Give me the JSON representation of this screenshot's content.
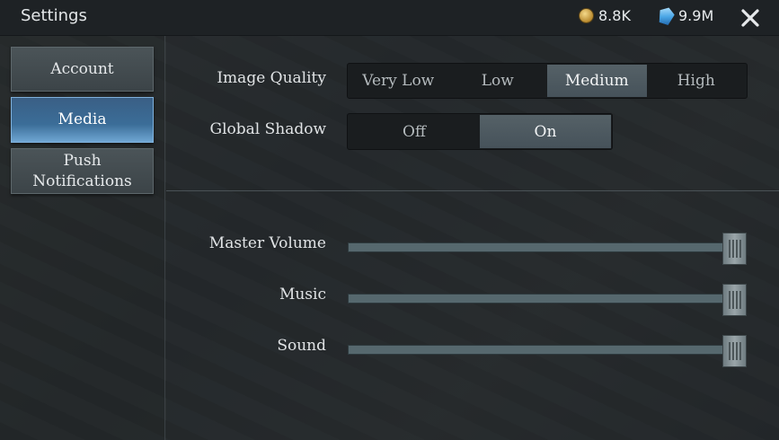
{
  "header": {
    "title": "Settings",
    "coins": {
      "icon": "coin-icon",
      "value": "8.8K"
    },
    "gems": {
      "icon": "gem-icon",
      "value": "9.9M"
    },
    "close_icon": "close-icon"
  },
  "sidebar": {
    "items": [
      {
        "label": "Account",
        "active": false
      },
      {
        "label": "Media",
        "active": true
      },
      {
        "label": "Push\nNotifications",
        "active": false
      }
    ]
  },
  "media": {
    "image_quality": {
      "label": "Image Quality",
      "options": [
        "Very Low",
        "Low",
        "Medium",
        "High"
      ],
      "selected": "Medium"
    },
    "global_shadow": {
      "label": "Global Shadow",
      "options": [
        "Off",
        "On"
      ],
      "selected": "On"
    },
    "master_volume": {
      "label": "Master Volume",
      "level": 1.0
    },
    "music": {
      "label": "Music",
      "level": 1.0
    },
    "sound": {
      "label": "Sound",
      "level": 1.0
    }
  },
  "colors": {
    "accent_active": "#3b6d98",
    "track": "#56686e",
    "selected_segment": "#4e5a60"
  }
}
